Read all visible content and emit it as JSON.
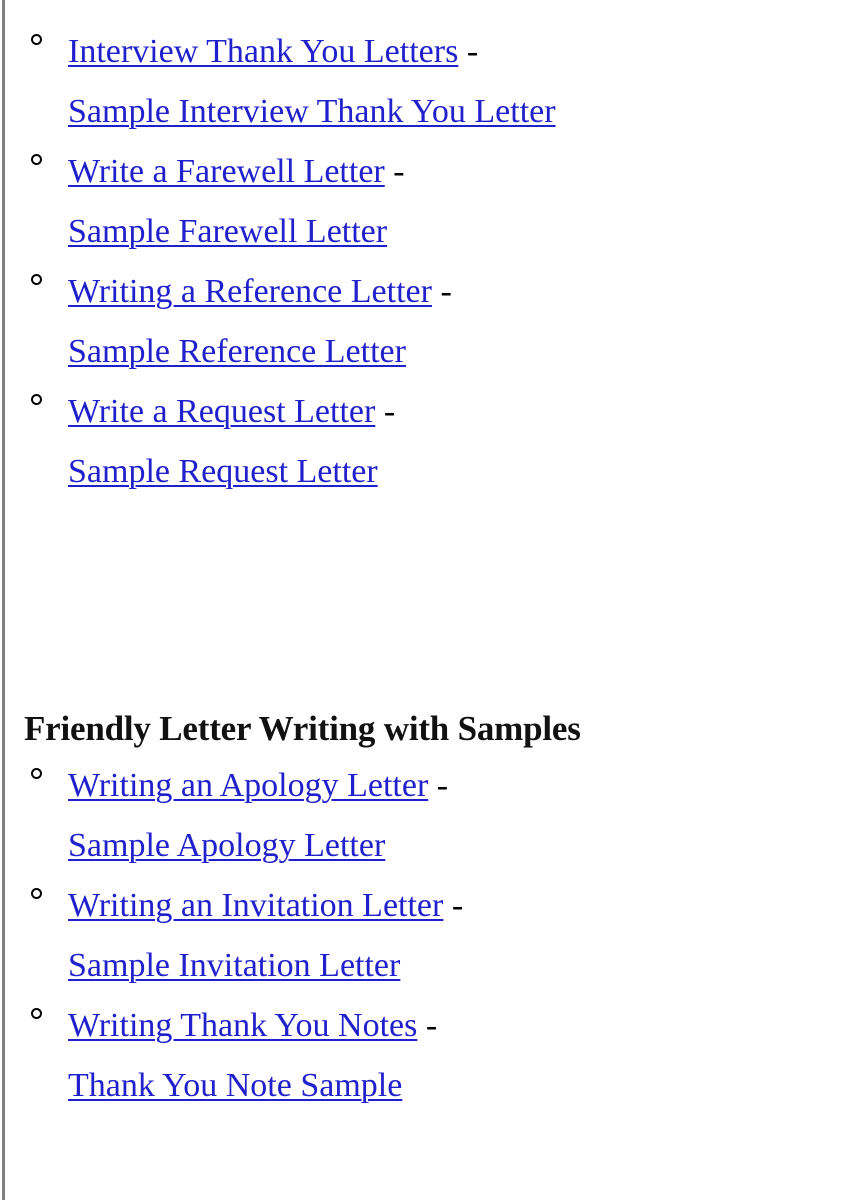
{
  "document": {
    "background_color": "#ffffff",
    "link_color": "#2020cc",
    "text_color": "#111111",
    "rule_color": "#808080",
    "separator": "-",
    "bullet_glyph": "o"
  },
  "sections": [
    {
      "heading": "",
      "items": [
        {
          "link": "Interview Thank You Letters",
          "separator": "-",
          "sample_link": "Sample Interview Thank You Letter"
        },
        {
          "link": "Write a Farewell Letter",
          "separator": "-",
          "sample_link": "Sample Farewell Letter"
        },
        {
          "link": "Writing a Reference Letter",
          "separator": "-",
          "sample_link": "Sample Reference Letter"
        },
        {
          "link": "Write a Request Letter",
          "separator": "-",
          "sample_link": "Sample Request Letter"
        }
      ]
    },
    {
      "heading": "Friendly Letter Writing with Samples",
      "items": [
        {
          "link": "Writing an Apology Letter",
          "separator": "-",
          "sample_link": "Sample Apology Letter"
        },
        {
          "link": "Writing an Invitation Letter",
          "separator": "-",
          "sample_link": "Sample Invitation Letter"
        },
        {
          "link": "Writing Thank You Notes",
          "separator": "-",
          "sample_link": "Thank You Note Sample"
        }
      ]
    }
  ]
}
